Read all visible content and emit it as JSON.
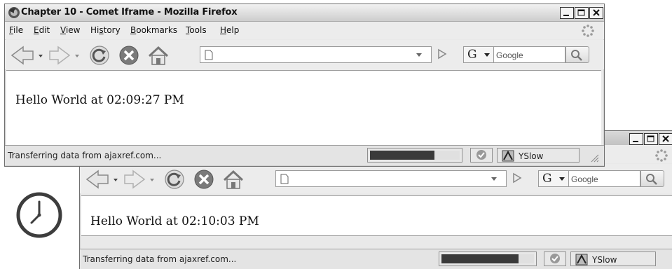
{
  "front_window": {
    "title": "Chapter 10 - Comet Iframe - Mozilla Firefox",
    "menu": [
      {
        "accel": "F",
        "rest": "ile"
      },
      {
        "accel": "E",
        "rest": "dit"
      },
      {
        "accel": "V",
        "rest": "iew"
      },
      {
        "pre": "Hi",
        "accel": "s",
        "rest": "tory"
      },
      {
        "accel": "B",
        "rest": "ookmarks"
      },
      {
        "accel": "T",
        "rest": "ools"
      },
      {
        "accel": "H",
        "rest": "elp"
      }
    ],
    "search_placeholder": "Google",
    "content_text": "Hello World at 02:09:27 PM",
    "status_text": "Transferring data from ajaxref.com...",
    "progress": 0.72,
    "yslow_label": "YSlow"
  },
  "back_window": {
    "search_placeholder": "Google",
    "content_text": "Hello World at 02:10:03 PM",
    "status_text": "Transferring data from ajaxref.com...",
    "progress": 0.83,
    "yslow_label": "YSlow"
  },
  "colors": {
    "chrome": "#e9e9e9",
    "progress": "#3a3a3a",
    "border": "#6f6f6f"
  },
  "icons": [
    "firefox-icon",
    "back-icon",
    "forward-icon",
    "reload-icon",
    "stop-icon",
    "home-icon",
    "page-icon",
    "throbber-icon",
    "clock-icon",
    "check-icon",
    "yslow-icon"
  ]
}
